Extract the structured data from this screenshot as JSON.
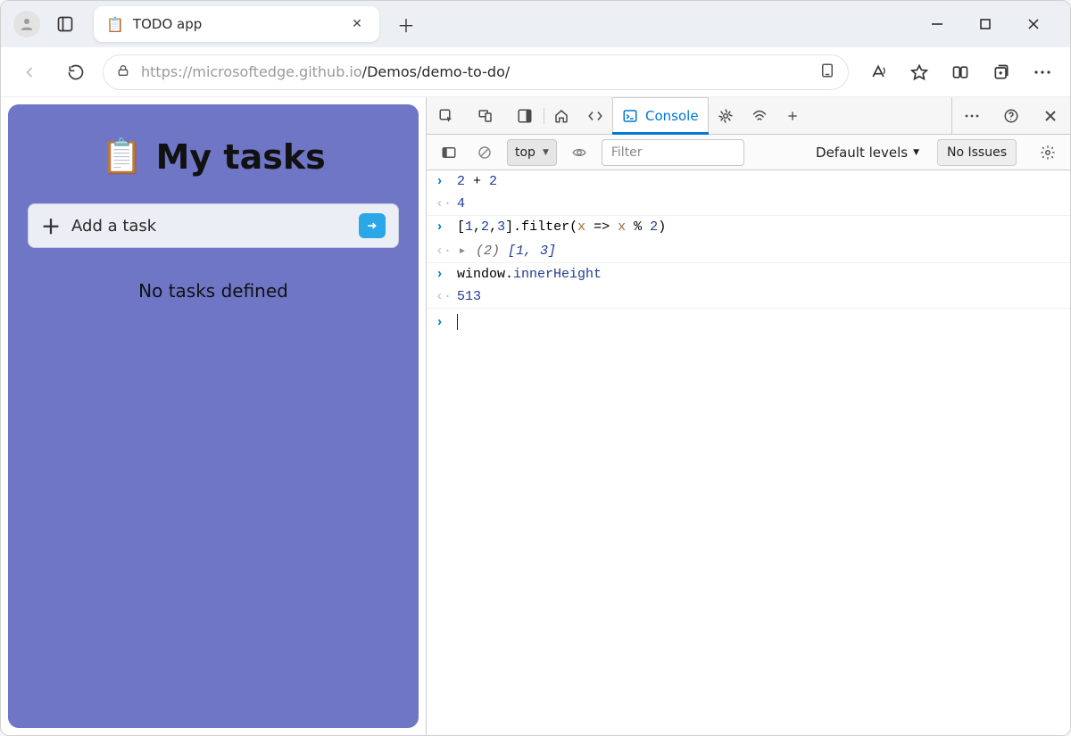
{
  "browser": {
    "tab_title": "TODO app",
    "url_gray": "https://microsoftedge.github.io",
    "url_path": "/Demos/demo-to-do/"
  },
  "todo": {
    "heading": "My tasks",
    "input_placeholder": "Add a task",
    "empty_state": "No tasks defined"
  },
  "devtools": {
    "tabs": {
      "console": "Console"
    },
    "toolbar": {
      "context": "top",
      "filter_placeholder": "Filter",
      "levels": "Default levels",
      "issues": "No Issues"
    },
    "console": {
      "line1_a": "2",
      "line1_op": " + ",
      "line1_b": "2",
      "result1": "4",
      "line2_a": "[",
      "line2_n1": "1",
      "line2_c1": ",",
      "line2_n2": "2",
      "line2_c2": ",",
      "line2_n3": "3",
      "line2_b": "].filter(",
      "line2_arg": "x",
      "line2_arrow": " => ",
      "line2_arg2": "x",
      "line2_mod": " % ",
      "line2_n4": "2",
      "line2_close": ")",
      "result2_count": "(2) ",
      "result2_body": "[1, 3]",
      "line3_a": "window",
      "line3_dot": ".",
      "line3_b": "innerHeight",
      "result3": "513"
    }
  }
}
